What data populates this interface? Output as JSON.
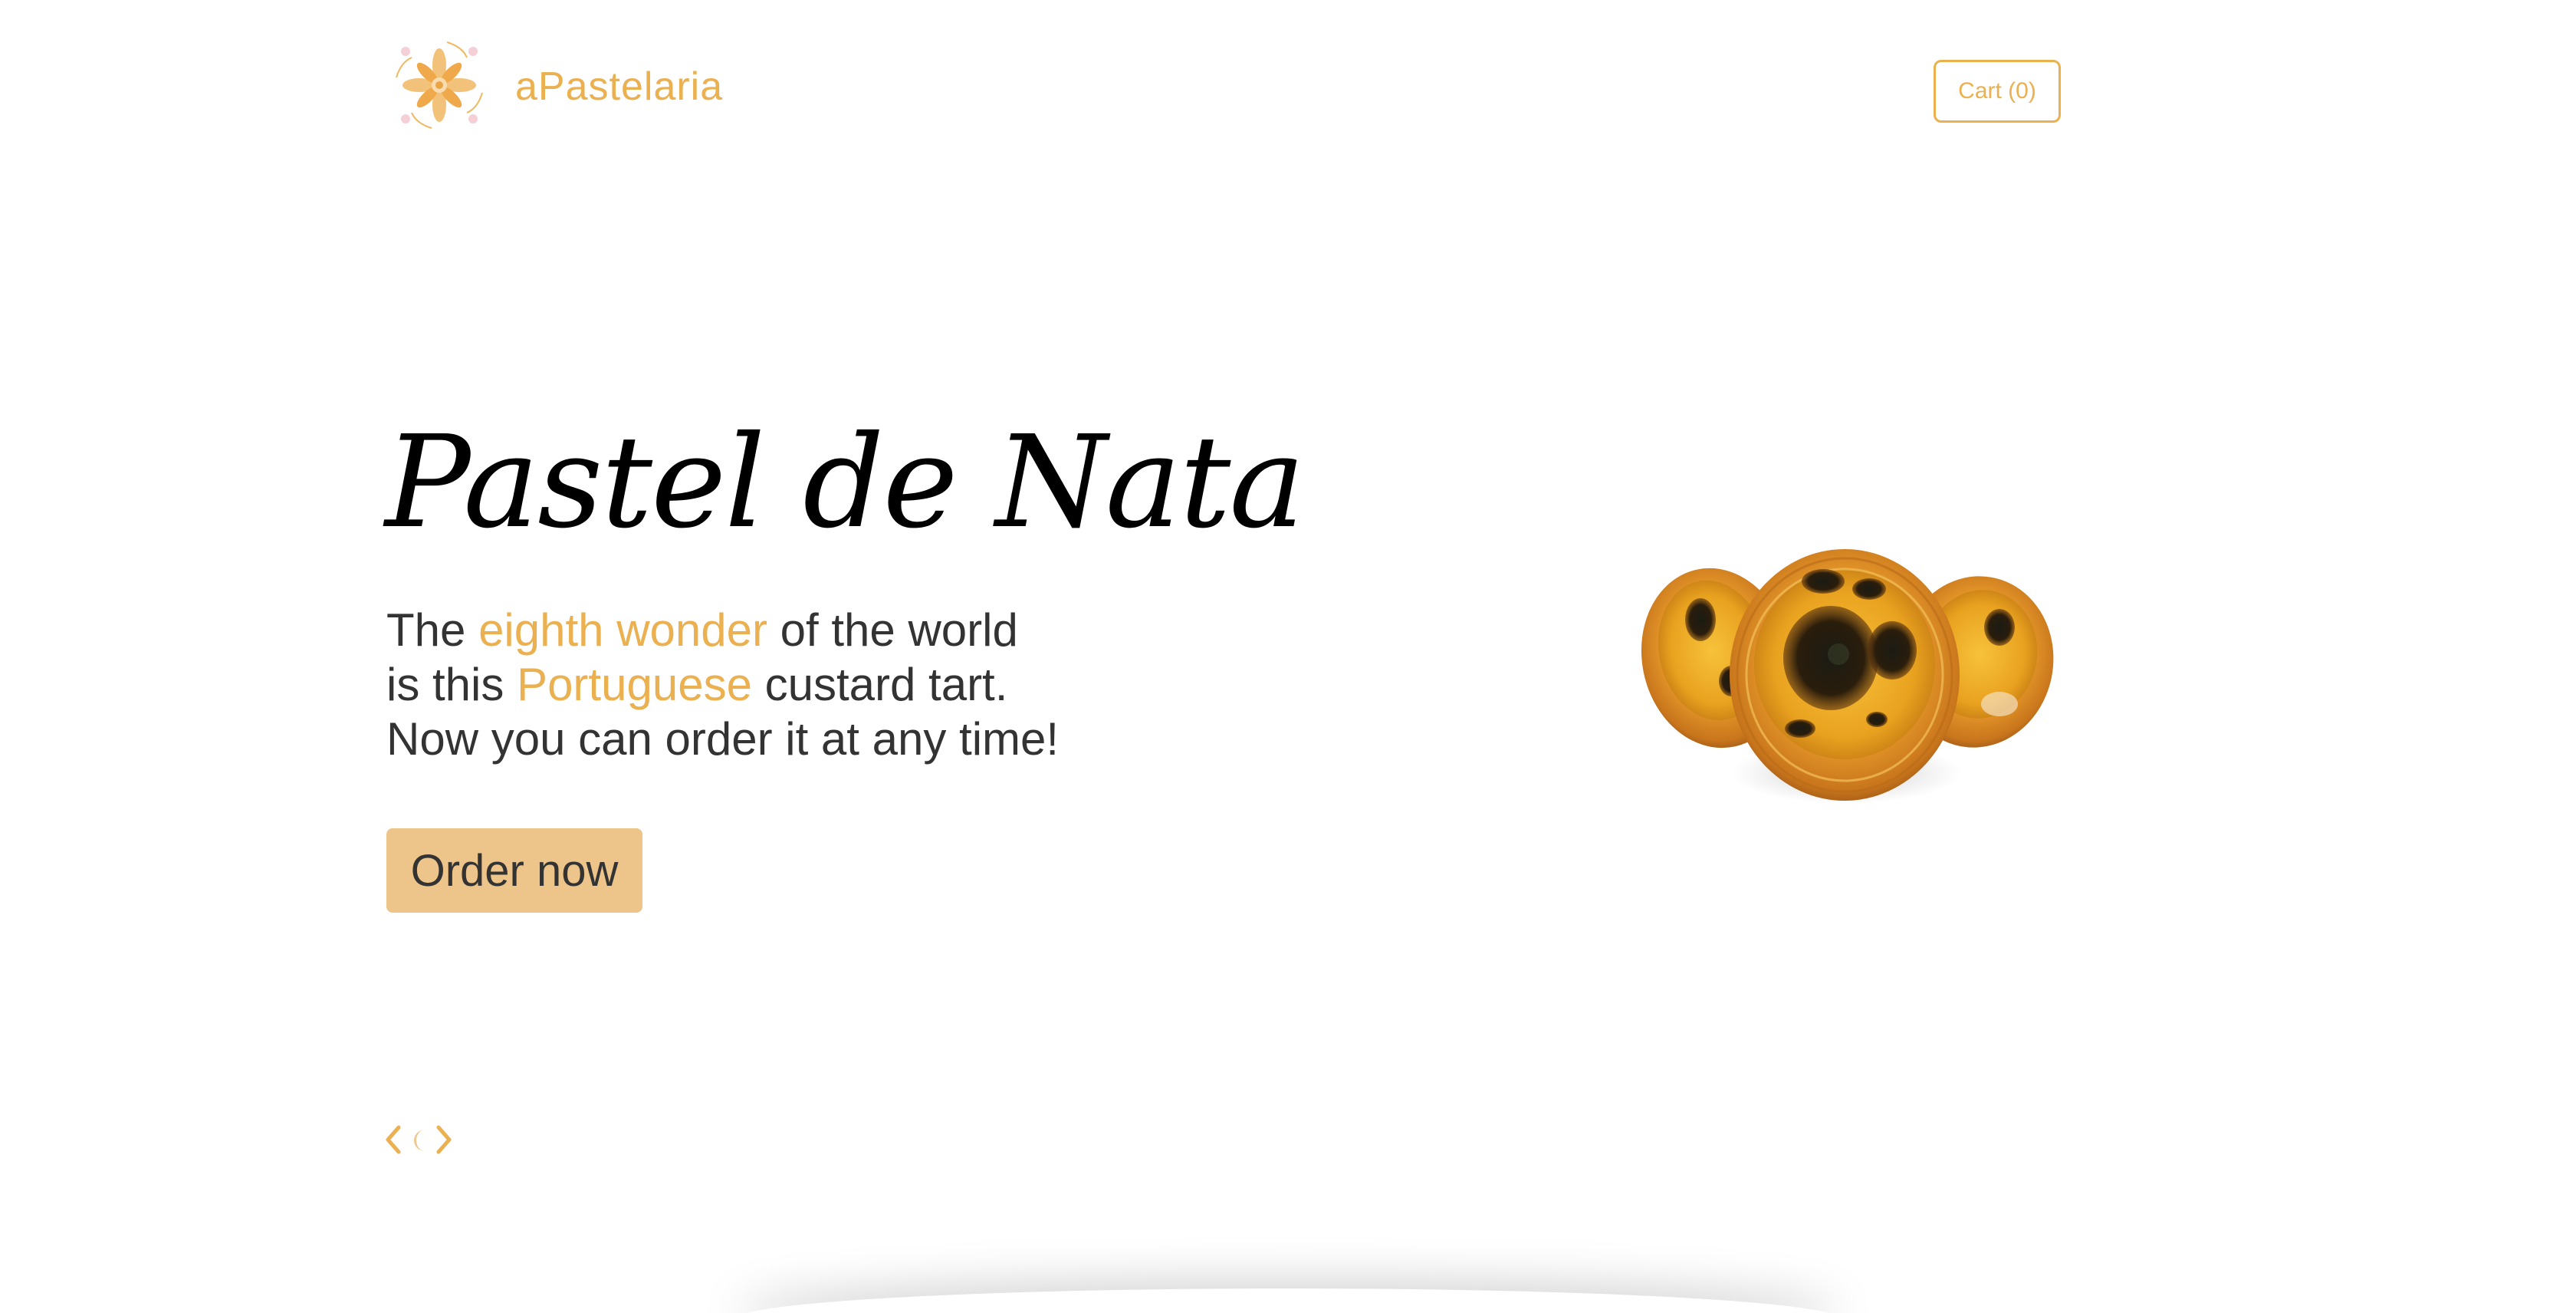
{
  "header": {
    "logo_icon": "floral-tile-logo-icon",
    "brand_name": "aPastelaria",
    "cart_label": "Cart (0)"
  },
  "hero": {
    "title": "Pastel de Nata",
    "line1_pre": "The ",
    "line1_accent": "eighth wonder",
    "line1_post": " of the world",
    "line2_pre": "is this ",
    "line2_accent": "Portuguese",
    "line2_post": " custard tart.",
    "line3": "Now you can order it at any time!",
    "cta_label": "Order now"
  },
  "slider": {
    "prev_icon": "chevron-left-icon",
    "theme_icon": "moon-icon",
    "next_icon": "chevron-right-icon"
  },
  "product_image": {
    "icon": "custard-tart-image"
  },
  "colors": {
    "accent": "#ebb04f",
    "button_bg": "#edc48a",
    "text": "#333333",
    "title": "#000000",
    "background": "#ffffff"
  }
}
